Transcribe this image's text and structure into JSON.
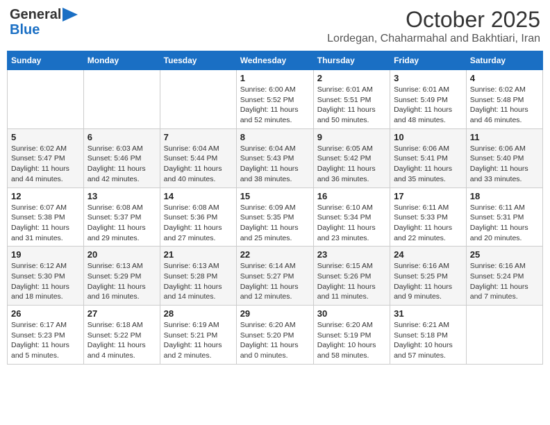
{
  "header": {
    "logo_general": "General",
    "logo_blue": "Blue",
    "month": "October 2025",
    "location": "Lordegan, Chaharmahal and Bakhtiari, Iran"
  },
  "weekdays": [
    "Sunday",
    "Monday",
    "Tuesday",
    "Wednesday",
    "Thursday",
    "Friday",
    "Saturday"
  ],
  "weeks": [
    [
      {
        "day": "",
        "sunrise": "",
        "sunset": "",
        "daylight": ""
      },
      {
        "day": "",
        "sunrise": "",
        "sunset": "",
        "daylight": ""
      },
      {
        "day": "",
        "sunrise": "",
        "sunset": "",
        "daylight": ""
      },
      {
        "day": "1",
        "sunrise": "Sunrise: 6:00 AM",
        "sunset": "Sunset: 5:52 PM",
        "daylight": "Daylight: 11 hours and 52 minutes."
      },
      {
        "day": "2",
        "sunrise": "Sunrise: 6:01 AM",
        "sunset": "Sunset: 5:51 PM",
        "daylight": "Daylight: 11 hours and 50 minutes."
      },
      {
        "day": "3",
        "sunrise": "Sunrise: 6:01 AM",
        "sunset": "Sunset: 5:49 PM",
        "daylight": "Daylight: 11 hours and 48 minutes."
      },
      {
        "day": "4",
        "sunrise": "Sunrise: 6:02 AM",
        "sunset": "Sunset: 5:48 PM",
        "daylight": "Daylight: 11 hours and 46 minutes."
      }
    ],
    [
      {
        "day": "5",
        "sunrise": "Sunrise: 6:02 AM",
        "sunset": "Sunset: 5:47 PM",
        "daylight": "Daylight: 11 hours and 44 minutes."
      },
      {
        "day": "6",
        "sunrise": "Sunrise: 6:03 AM",
        "sunset": "Sunset: 5:46 PM",
        "daylight": "Daylight: 11 hours and 42 minutes."
      },
      {
        "day": "7",
        "sunrise": "Sunrise: 6:04 AM",
        "sunset": "Sunset: 5:44 PM",
        "daylight": "Daylight: 11 hours and 40 minutes."
      },
      {
        "day": "8",
        "sunrise": "Sunrise: 6:04 AM",
        "sunset": "Sunset: 5:43 PM",
        "daylight": "Daylight: 11 hours and 38 minutes."
      },
      {
        "day": "9",
        "sunrise": "Sunrise: 6:05 AM",
        "sunset": "Sunset: 5:42 PM",
        "daylight": "Daylight: 11 hours and 36 minutes."
      },
      {
        "day": "10",
        "sunrise": "Sunrise: 6:06 AM",
        "sunset": "Sunset: 5:41 PM",
        "daylight": "Daylight: 11 hours and 35 minutes."
      },
      {
        "day": "11",
        "sunrise": "Sunrise: 6:06 AM",
        "sunset": "Sunset: 5:40 PM",
        "daylight": "Daylight: 11 hours and 33 minutes."
      }
    ],
    [
      {
        "day": "12",
        "sunrise": "Sunrise: 6:07 AM",
        "sunset": "Sunset: 5:38 PM",
        "daylight": "Daylight: 11 hours and 31 minutes."
      },
      {
        "day": "13",
        "sunrise": "Sunrise: 6:08 AM",
        "sunset": "Sunset: 5:37 PM",
        "daylight": "Daylight: 11 hours and 29 minutes."
      },
      {
        "day": "14",
        "sunrise": "Sunrise: 6:08 AM",
        "sunset": "Sunset: 5:36 PM",
        "daylight": "Daylight: 11 hours and 27 minutes."
      },
      {
        "day": "15",
        "sunrise": "Sunrise: 6:09 AM",
        "sunset": "Sunset: 5:35 PM",
        "daylight": "Daylight: 11 hours and 25 minutes."
      },
      {
        "day": "16",
        "sunrise": "Sunrise: 6:10 AM",
        "sunset": "Sunset: 5:34 PM",
        "daylight": "Daylight: 11 hours and 23 minutes."
      },
      {
        "day": "17",
        "sunrise": "Sunrise: 6:11 AM",
        "sunset": "Sunset: 5:33 PM",
        "daylight": "Daylight: 11 hours and 22 minutes."
      },
      {
        "day": "18",
        "sunrise": "Sunrise: 6:11 AM",
        "sunset": "Sunset: 5:31 PM",
        "daylight": "Daylight: 11 hours and 20 minutes."
      }
    ],
    [
      {
        "day": "19",
        "sunrise": "Sunrise: 6:12 AM",
        "sunset": "Sunset: 5:30 PM",
        "daylight": "Daylight: 11 hours and 18 minutes."
      },
      {
        "day": "20",
        "sunrise": "Sunrise: 6:13 AM",
        "sunset": "Sunset: 5:29 PM",
        "daylight": "Daylight: 11 hours and 16 minutes."
      },
      {
        "day": "21",
        "sunrise": "Sunrise: 6:13 AM",
        "sunset": "Sunset: 5:28 PM",
        "daylight": "Daylight: 11 hours and 14 minutes."
      },
      {
        "day": "22",
        "sunrise": "Sunrise: 6:14 AM",
        "sunset": "Sunset: 5:27 PM",
        "daylight": "Daylight: 11 hours and 12 minutes."
      },
      {
        "day": "23",
        "sunrise": "Sunrise: 6:15 AM",
        "sunset": "Sunset: 5:26 PM",
        "daylight": "Daylight: 11 hours and 11 minutes."
      },
      {
        "day": "24",
        "sunrise": "Sunrise: 6:16 AM",
        "sunset": "Sunset: 5:25 PM",
        "daylight": "Daylight: 11 hours and 9 minutes."
      },
      {
        "day": "25",
        "sunrise": "Sunrise: 6:16 AM",
        "sunset": "Sunset: 5:24 PM",
        "daylight": "Daylight: 11 hours and 7 minutes."
      }
    ],
    [
      {
        "day": "26",
        "sunrise": "Sunrise: 6:17 AM",
        "sunset": "Sunset: 5:23 PM",
        "daylight": "Daylight: 11 hours and 5 minutes."
      },
      {
        "day": "27",
        "sunrise": "Sunrise: 6:18 AM",
        "sunset": "Sunset: 5:22 PM",
        "daylight": "Daylight: 11 hours and 4 minutes."
      },
      {
        "day": "28",
        "sunrise": "Sunrise: 6:19 AM",
        "sunset": "Sunset: 5:21 PM",
        "daylight": "Daylight: 11 hours and 2 minutes."
      },
      {
        "day": "29",
        "sunrise": "Sunrise: 6:20 AM",
        "sunset": "Sunset: 5:20 PM",
        "daylight": "Daylight: 11 hours and 0 minutes."
      },
      {
        "day": "30",
        "sunrise": "Sunrise: 6:20 AM",
        "sunset": "Sunset: 5:19 PM",
        "daylight": "Daylight: 10 hours and 58 minutes."
      },
      {
        "day": "31",
        "sunrise": "Sunrise: 6:21 AM",
        "sunset": "Sunset: 5:18 PM",
        "daylight": "Daylight: 10 hours and 57 minutes."
      },
      {
        "day": "",
        "sunrise": "",
        "sunset": "",
        "daylight": ""
      }
    ]
  ]
}
